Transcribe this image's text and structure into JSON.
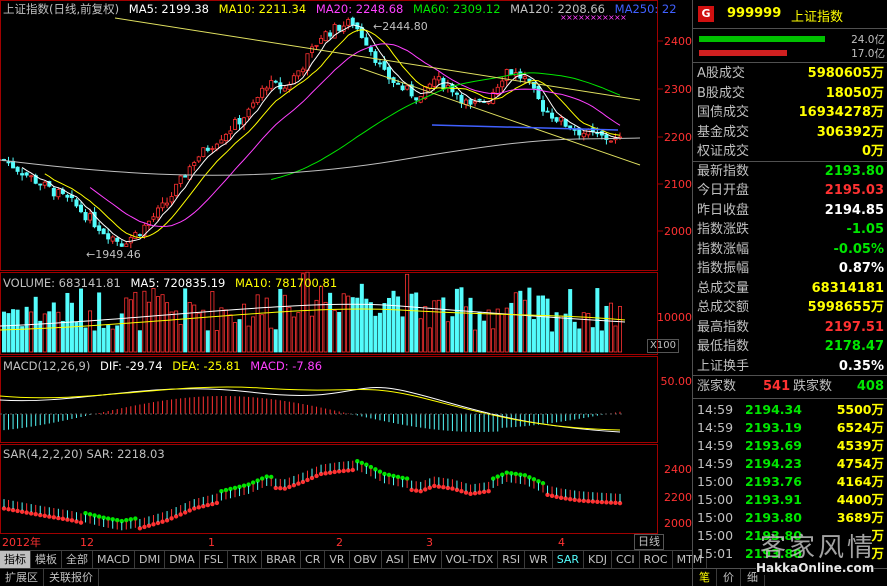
{
  "header": {
    "price_title": "上证指数(日线,前复权)",
    "ma5": "MA5: 2199.38",
    "ma10": "MA10: 2211.34",
    "ma20": "MA20: 2248.68",
    "ma60": "MA60: 2309.12",
    "ma120": "MA120: 2208.66",
    "ma250": "MA250: 22",
    "volume": "VOLUME: 683141.81",
    "vol_ma5": "MA5: 720835.19",
    "vol_ma10": "MA10: 781700.81",
    "macd_name": "MACD(12,26,9)",
    "dif": "DIF: -29.74",
    "dea": "DEA: -25.81",
    "macd": "MACD: -7.86",
    "sar": "SAR(4,2,2,20)  SAR: 2218.03"
  },
  "annotations": {
    "high": "←2444.80",
    "low": "←1949.46"
  },
  "price_axis": [
    "2400",
    "2300",
    "2200",
    "2100",
    "2000"
  ],
  "volume_axis": [
    "10000"
  ],
  "volume_unit": "X100",
  "macd_axis": [
    "50.00"
  ],
  "sar_axis": [
    "2400",
    "2200",
    "2000"
  ],
  "dates": [
    "2012年",
    "12",
    "1",
    "2",
    "3",
    "4"
  ],
  "period_label": "日线",
  "indicator_tabs": [
    "指标",
    "模板",
    "全部",
    "MACD",
    "DMI",
    "DMA",
    "FSL",
    "TRIX",
    "BRAR",
    "CR",
    "VR",
    "OBV",
    "ASI",
    "EMV",
    "VOL-TDX",
    "RSI",
    "WR",
    "SAR",
    "KDJ",
    "CCI",
    "ROC",
    "MTM"
  ],
  "selected_tab": "SAR",
  "bottom_tabs": [
    "扩展区",
    "关联报价"
  ],
  "colors": {
    "up": "#ff3232",
    "down": "#54fcfc",
    "ma5": "#ffffff",
    "ma10": "#ffff00",
    "ma20": "#ff40ff",
    "ma60": "#00e600",
    "ma120": "#c0c0c0"
  },
  "quote": {
    "badge": "G",
    "code": "999999",
    "name": "上证指数",
    "bar_up_label": "24.0亿",
    "bar_down_label": "17.0亿",
    "rows": [
      {
        "k": "A股成交",
        "v": "5980605万",
        "c": "yellow"
      },
      {
        "k": "B股成交",
        "v": "18050万",
        "c": "yellow"
      },
      {
        "k": "国债成交",
        "v": "16934278万",
        "c": "yellow"
      },
      {
        "k": "基金成交",
        "v": "306392万",
        "c": "yellow"
      },
      {
        "k": "权证成交",
        "v": "0万",
        "c": "yellow"
      },
      {
        "k": "最新指数",
        "v": "2193.80",
        "c": "green"
      },
      {
        "k": "今日开盘",
        "v": "2195.03",
        "c": "red"
      },
      {
        "k": "昨日收盘",
        "v": "2194.85",
        "c": "white"
      },
      {
        "k": "指数涨跌",
        "v": "-1.05",
        "c": "green"
      },
      {
        "k": "指数涨幅",
        "v": "-0.05%",
        "c": "green"
      },
      {
        "k": "指数振幅",
        "v": "0.87%",
        "c": "white"
      },
      {
        "k": "总成交量",
        "v": "68314181",
        "c": "yellow"
      },
      {
        "k": "总成交额",
        "v": "5998655万",
        "c": "yellow"
      },
      {
        "k": "最高指数",
        "v": "2197.51",
        "c": "red"
      },
      {
        "k": "最低指数",
        "v": "2178.47",
        "c": "green"
      },
      {
        "k": "上证换手",
        "v": "0.35%",
        "c": "white"
      }
    ],
    "up_count_label": "涨家数",
    "up_count": "541",
    "down_count_label": "跌家数",
    "down_count": "408",
    "ticks": [
      {
        "t": "14:59",
        "p": "2194.34",
        "c": "green",
        "v": "5500万"
      },
      {
        "t": "14:59",
        "p": "2193.19",
        "c": "green",
        "v": "6524万"
      },
      {
        "t": "14:59",
        "p": "2193.69",
        "c": "green",
        "v": "4539万"
      },
      {
        "t": "14:59",
        "p": "2194.23",
        "c": "green",
        "v": "4754万"
      },
      {
        "t": "15:00",
        "p": "2193.76",
        "c": "green",
        "v": "4164万"
      },
      {
        "t": "15:00",
        "p": "2193.91",
        "c": "green",
        "v": "4400万"
      },
      {
        "t": "15:00",
        "p": "2193.80",
        "c": "green",
        "v": "3689万"
      },
      {
        "t": "15:00",
        "p": "2193.80",
        "c": "green",
        "v": "万"
      },
      {
        "t": "15:01",
        "p": "2193.80",
        "c": "green",
        "v": "万"
      }
    ],
    "foot_tabs": [
      "笔",
      "价",
      "细"
    ]
  },
  "watermark": {
    "text": "客家风情",
    "site": "HakkaOnline.com"
  }
}
